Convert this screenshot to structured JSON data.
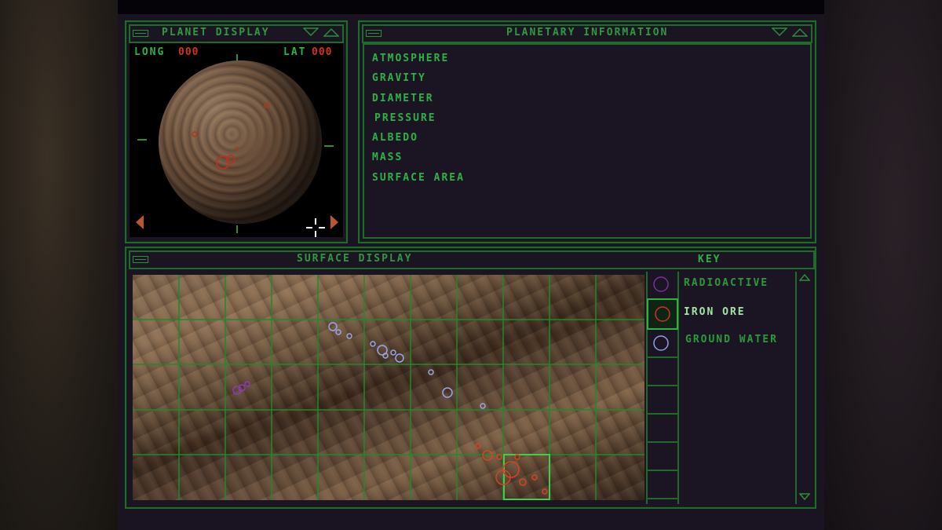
{
  "colors": {
    "panel_border": "#1f6b2a",
    "label_green": "#2eb243",
    "coord_red": "#d6301f",
    "background": "#1a1422"
  },
  "planet_display": {
    "title": "PLANET DISPLAY",
    "long_label": "LONG",
    "long_value": "000",
    "lat_label": "LAT",
    "lat_value": "000",
    "icons": [
      "collapse-icon",
      "triangle-down-icon",
      "triangle-up-icon",
      "rotate-left-icon",
      "rotate-right-icon",
      "crosshair-icon"
    ]
  },
  "planetary_information": {
    "title": "PLANETARY INFORMATION",
    "fields": [
      "ATMOSPHERE",
      "GRAVITY",
      "DIAMETER",
      "PRESSURE",
      "ALBEDO",
      "MASS",
      "SURFACE AREA"
    ]
  },
  "surface_display": {
    "title": "SURFACE DISPLAY",
    "key_title": "KEY",
    "key_items": [
      {
        "label": "RADIOACTIVE",
        "color": "#7a2f9c",
        "selected": false
      },
      {
        "label": "IRON ORE",
        "color": "#c8361f",
        "selected": true
      },
      {
        "label": "GROUND WATER",
        "color": "#8f9ee6",
        "selected": false
      }
    ],
    "icons": [
      "scroll-up-icon",
      "scroll-down-icon"
    ]
  }
}
